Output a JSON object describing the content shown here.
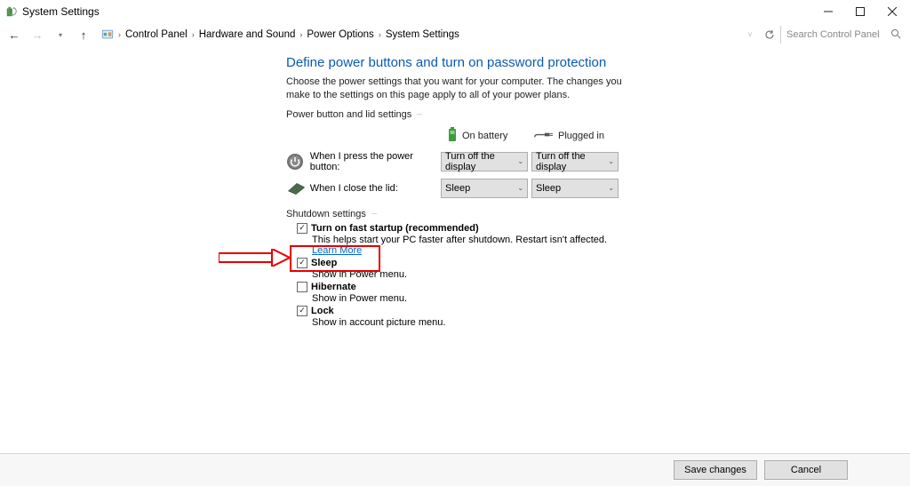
{
  "window": {
    "title": "System Settings"
  },
  "breadcrumb": {
    "items": [
      "Control Panel",
      "Hardware and Sound",
      "Power Options",
      "System Settings"
    ]
  },
  "search": {
    "placeholder": "Search Control Panel"
  },
  "page": {
    "title": "Define power buttons and turn on password protection",
    "subtitle": "Choose the power settings that you want for your computer. The changes you make to the settings on this page apply to all of your power plans."
  },
  "sections": {
    "powerlid": {
      "legend": "Power button and lid settings",
      "col_battery": "On battery",
      "col_plugged": "Plugged in",
      "rows": [
        {
          "label": "When I press the power button:",
          "battery": "Turn off the display",
          "plugged": "Turn off the display"
        },
        {
          "label": "When I close the lid:",
          "battery": "Sleep",
          "plugged": "Sleep"
        }
      ]
    },
    "shutdown": {
      "legend": "Shutdown settings",
      "items": [
        {
          "checked": true,
          "title": "Turn on fast startup (recommended)",
          "desc": "This helps start your PC faster after shutdown. Restart isn't affected. ",
          "link": "Learn More"
        },
        {
          "checked": true,
          "title": "Sleep",
          "desc": "Show in Power menu."
        },
        {
          "checked": false,
          "title": "Hibernate",
          "desc": "Show in Power menu."
        },
        {
          "checked": true,
          "title": "Lock",
          "desc": "Show in account picture menu."
        }
      ]
    }
  },
  "footer": {
    "save": "Save changes",
    "cancel": "Cancel"
  }
}
